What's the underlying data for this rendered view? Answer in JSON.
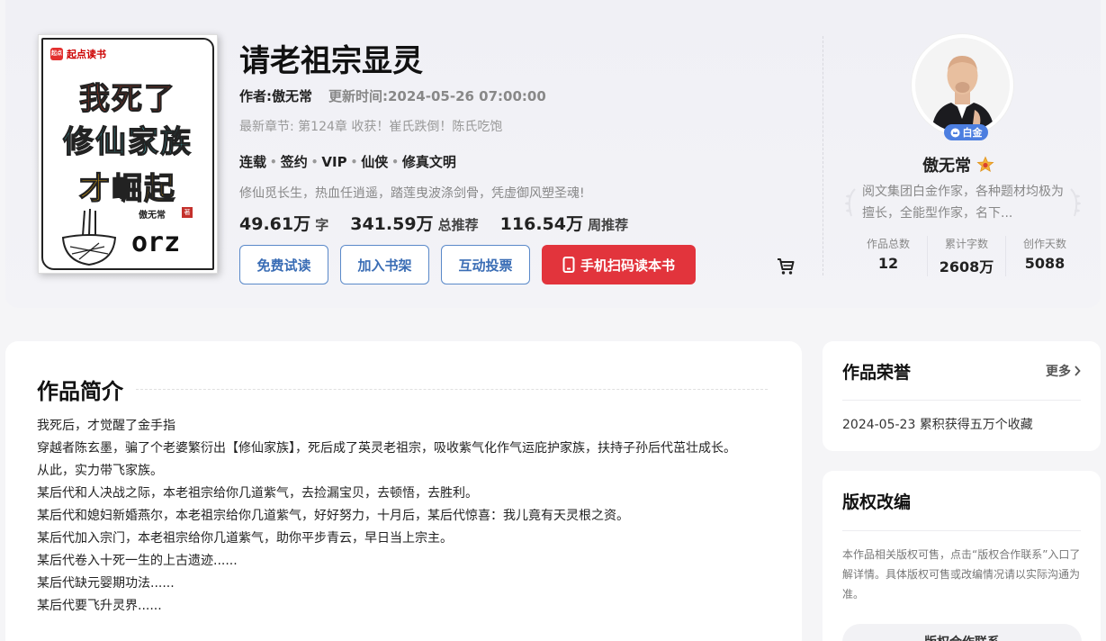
{
  "cover": {
    "brand": "起点读书",
    "brand_logo": "起点",
    "line1": "我死了",
    "line2": "修仙家族",
    "line3": "才崛起",
    "author": "傲无常",
    "seal": "著",
    "orz": "orz"
  },
  "book": {
    "title": "请老祖宗显灵",
    "author_label": "作者:傲无常",
    "update_label": "更新时间:2024-05-26 07:00:00",
    "latest": "最新章节: 第124章 收获！崔氏跌倒！陈氏吃饱",
    "tags": [
      "连载",
      "签约",
      "VIP",
      "仙侠",
      "修真文明"
    ],
    "tagline": "修仙觅长生，热血任逍遥，踏莲曳波涤剑骨，凭虚御风塑圣魂!",
    "stats": [
      {
        "num": "49.61万",
        "unit": "字"
      },
      {
        "num": "341.59万",
        "unit": "总推荐"
      },
      {
        "num": "116.54万",
        "unit": "周推荐"
      }
    ]
  },
  "buttons": {
    "trial": "免费试读",
    "shelf": "加入书架",
    "vote": "互动投票",
    "scan": "手机扫码读本书"
  },
  "author_panel": {
    "badge": "白金",
    "name": "傲无常",
    "desc": "阅文集团白金作家，各种题材均极为擅长，全能型作家，名下...",
    "stats": [
      {
        "label": "作品总数",
        "value": "12"
      },
      {
        "label": "累计字数",
        "value": "2608万"
      },
      {
        "label": "创作天数",
        "value": "5088"
      }
    ]
  },
  "intro": {
    "heading": "作品简介",
    "lines": [
      "我死后，才觉醒了金手指",
      "穿越者陈玄墨，骗了个老婆繁衍出【修仙家族】，死后成了英灵老祖宗，吸收紫气化作气运庇护家族，扶持子孙后代茁壮成长。",
      "从此，实力带飞家族。",
      "某后代和人决战之际，本老祖宗给你几道紫气，去捡漏宝贝，去顿悟，去胜利。",
      "某后代和媳妇新婚燕尔，本老祖宗给你几道紫气，好好努力，十月后，某后代惊喜：我儿竟有天灵根之资。",
      "某后代加入宗门，本老祖宗给你几道紫气，助你平步青云，早日当上宗主。",
      "某后代卷入十死一生的上古遗迹......",
      "某后代缺元婴期功法......",
      "某后代要飞升灵界......"
    ]
  },
  "honor": {
    "title": "作品荣誉",
    "more": "更多",
    "item": "2024-05-23 累积获得五万个收藏"
  },
  "copyright": {
    "title": "版权改编",
    "text": "本作品相关版权可售，点击“版权合作联系”入口了解详情。具体版权可售或改编情况请以实际沟通为准。",
    "button": "版权合作联系"
  }
}
